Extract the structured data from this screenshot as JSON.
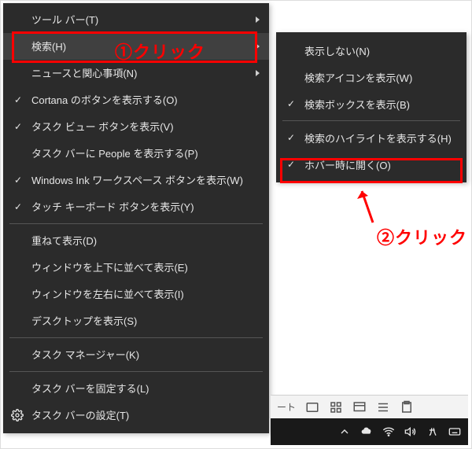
{
  "annotations": {
    "click1": "①クリック",
    "click2": "②クリック"
  },
  "main_menu": {
    "toolbars": "ツール バー(T)",
    "search": "検索(H)",
    "news": "ニュースと関心事項(N)",
    "cortana": "Cortana のボタンを表示する(O)",
    "taskview": "タスク ビュー ボタンを表示(V)",
    "people": "タスク バーに People を表示する(P)",
    "ink": "Windows Ink ワークスペース ボタンを表示(W)",
    "touchkb": "タッチ キーボード ボタンを表示(Y)",
    "cascade": "重ねて表示(D)",
    "stack_v": "ウィンドウを上下に並べて表示(E)",
    "stack_h": "ウィンドウを左右に並べて表示(I)",
    "show_desktop": "デスクトップを表示(S)",
    "taskmgr": "タスク マネージャー(K)",
    "lock_tb": "タスク バーを固定する(L)",
    "tb_settings": "タスク バーの設定(T)"
  },
  "submenu": {
    "hidden": "表示しない(N)",
    "show_icon": "検索アイコンを表示(W)",
    "show_box": "検索ボックスを表示(B)",
    "highlights": "検索のハイライトを表示する(H)",
    "open_hover": "ホバー時に開く(O)"
  },
  "doc_strip": {
    "label": "ート"
  }
}
